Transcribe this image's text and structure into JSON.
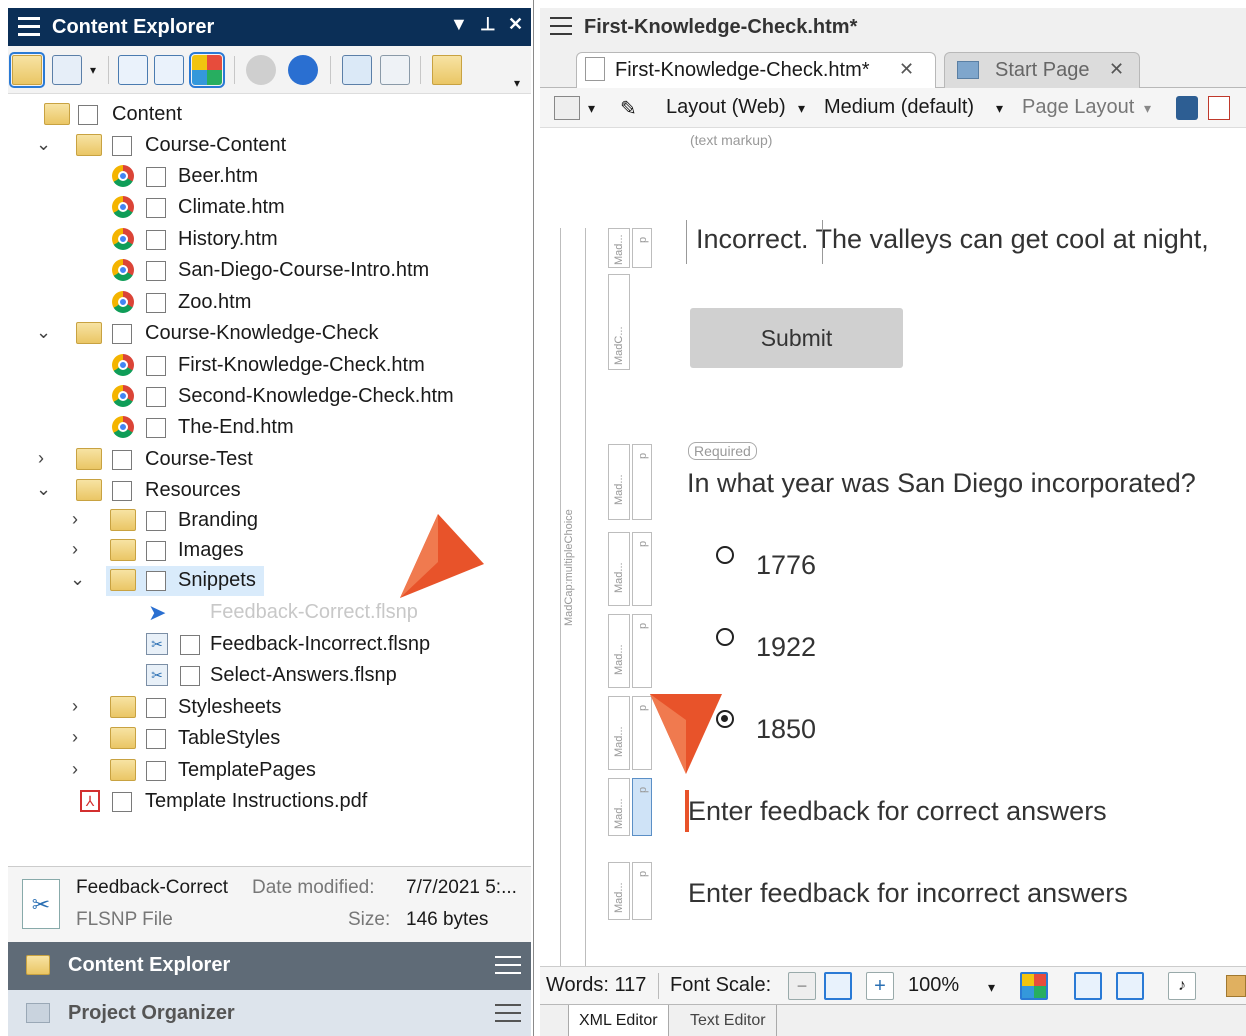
{
  "content_explorer": {
    "title": "Content Explorer",
    "tree": [
      {
        "label": "Content",
        "icon": "open-folder-icon"
      },
      {
        "label": "Course-Content",
        "icon": "open-folder-icon",
        "expanded": true
      },
      {
        "label": "Beer.htm",
        "icon": "chrome-icon"
      },
      {
        "label": "Climate.htm",
        "icon": "chrome-icon"
      },
      {
        "label": "History.htm",
        "icon": "chrome-icon"
      },
      {
        "label": "San-Diego-Course-Intro.htm",
        "icon": "chrome-icon"
      },
      {
        "label": "Zoo.htm",
        "icon": "chrome-icon"
      },
      {
        "label": "Course-Knowledge-Check",
        "icon": "open-folder-icon",
        "expanded": true
      },
      {
        "label": "First-Knowledge-Check.htm",
        "icon": "chrome-icon"
      },
      {
        "label": "Second-Knowledge-Check.htm",
        "icon": "chrome-icon"
      },
      {
        "label": "The-End.htm",
        "icon": "chrome-icon"
      },
      {
        "label": "Course-Test",
        "icon": "folder-icon",
        "expanded": false
      },
      {
        "label": "Resources",
        "icon": "open-folder-icon",
        "expanded": true
      },
      {
        "label": "Branding",
        "icon": "folder-icon",
        "expanded": false
      },
      {
        "label": "Images",
        "icon": "folder-icon",
        "expanded": false
      },
      {
        "label": "Snippets",
        "icon": "open-folder-icon",
        "expanded": true,
        "selected": true
      },
      {
        "label": "Feedback-Correct.flsnp",
        "icon": "cursor-icon",
        "dragging": true
      },
      {
        "label": "Feedback-Incorrect.flsnp",
        "icon": "snippet-icon"
      },
      {
        "label": "Select-Answers.flsnp",
        "icon": "snippet-icon"
      },
      {
        "label": "Stylesheets",
        "icon": "folder-icon",
        "expanded": false
      },
      {
        "label": "TableStyles",
        "icon": "folder-icon",
        "expanded": false
      },
      {
        "label": "TemplatePages",
        "icon": "folder-icon",
        "expanded": false
      },
      {
        "label": "Template Instructions.pdf",
        "icon": "pdf-icon"
      }
    ],
    "details": {
      "name": "Feedback-Correct",
      "type": "FLSNP File",
      "date_label": "Date modified:",
      "date_value": "7/7/2021 5:...",
      "size_label": "Size:",
      "size_value": "146 bytes"
    },
    "bottom_tabs": [
      "Content Explorer",
      "Project Organizer"
    ]
  },
  "editor": {
    "window_title": "First-Knowledge-Check.htm*",
    "tabs": [
      {
        "label": "First-Knowledge-Check.htm*",
        "active": true
      },
      {
        "label": "Start Page",
        "active": false
      }
    ],
    "toolbar": {
      "layout": "Layout (Web)",
      "medium": "Medium (default)",
      "page_layout": "Page Layout"
    },
    "text_markup": "(text markup)",
    "gutter_label": "MadCap:multipleChoice",
    "gutter_tags": [
      "Mad...",
      "MadC...",
      "Mad...",
      "Mad...",
      "Mad...",
      "Mad...",
      "Mad...",
      "Mad..."
    ],
    "p_tag": "p",
    "incorrect_line": "Incorrect. The valleys can get cool at night,",
    "submit_label": "Submit",
    "required_badge": "Required",
    "question": "In what year was San Diego incorporated?",
    "answers": [
      {
        "label": "1776",
        "selected": false
      },
      {
        "label": "1922",
        "selected": false
      },
      {
        "label": "1850",
        "selected": true
      }
    ],
    "feedback_correct": "Enter feedback for correct answers",
    "feedback_incorrect": "Enter feedback for incorrect answers",
    "status": {
      "words": "Words: 117",
      "font_scale": "Font Scale:",
      "zoom": "100%"
    },
    "bottom_tabs": [
      "XML Editor",
      "Text Editor"
    ]
  },
  "colors": {
    "title_bar": "#0b2f57",
    "accent_arrow": "#e8532a",
    "selection": "#d9ebfb"
  }
}
